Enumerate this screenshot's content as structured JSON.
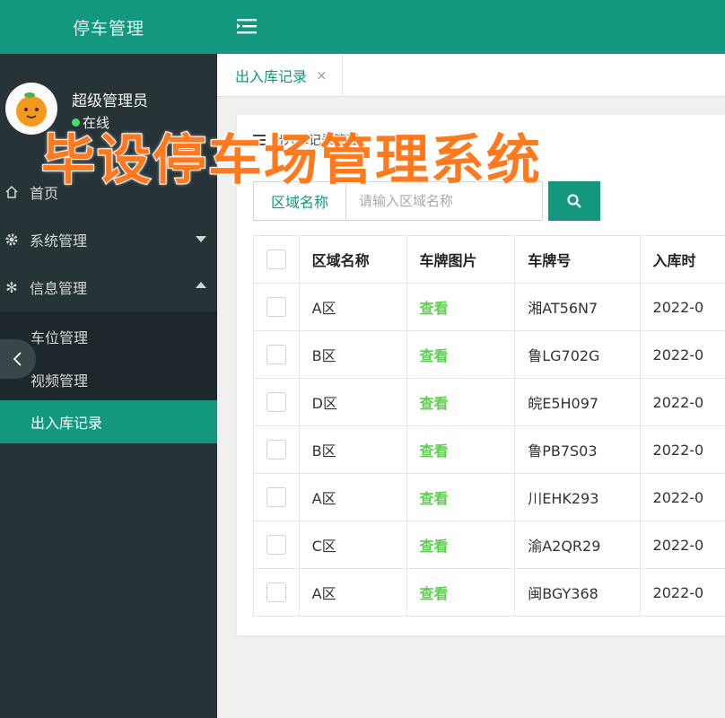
{
  "brand": {
    "title": "停车管理"
  },
  "user": {
    "name": "超级管理员",
    "status": "在线"
  },
  "sidebar": {
    "items": [
      {
        "label": "首页",
        "icon": "home-icon"
      },
      {
        "label": "系统管理",
        "icon": "gear-icon"
      },
      {
        "label": "信息管理",
        "icon": "snowflake-icon"
      }
    ],
    "submenu": [
      {
        "label": "车位管理"
      },
      {
        "label": "视频管理"
      },
      {
        "label": "出入库记录",
        "active": true
      }
    ]
  },
  "tabs": [
    {
      "label": "出入库记录",
      "close": "×"
    }
  ],
  "card": {
    "title": "出入库记录管理"
  },
  "search": {
    "label": "区域名称",
    "placeholder": "请输入区域名称"
  },
  "table": {
    "headers": [
      "区域名称",
      "车牌图片",
      "车牌号",
      "入库时"
    ],
    "rows": [
      {
        "area": "A区",
        "image": "查看",
        "plate": "湘AT56N7",
        "time": "2022-0"
      },
      {
        "area": "B区",
        "image": "查看",
        "plate": "鲁LG702G",
        "time": "2022-0"
      },
      {
        "area": "D区",
        "image": "查看",
        "plate": "皖E5H097",
        "time": "2022-0"
      },
      {
        "area": "B区",
        "image": "查看",
        "plate": "鲁PB7S03",
        "time": "2022-0"
      },
      {
        "area": "A区",
        "image": "查看",
        "plate": "川EHK293",
        "time": "2022-0"
      },
      {
        "area": "C区",
        "image": "查看",
        "plate": "渝A2QR29",
        "time": "2022-0"
      },
      {
        "area": "A区",
        "image": "查看",
        "plate": "闽BGY368",
        "time": "2022-0"
      }
    ]
  },
  "overlay": {
    "text": "毕设停车场管理系统"
  },
  "colors": {
    "primary": "#13987f",
    "sidebar": "#283338",
    "overlay": "#ff7a1f",
    "link": "#5ccf4c"
  }
}
